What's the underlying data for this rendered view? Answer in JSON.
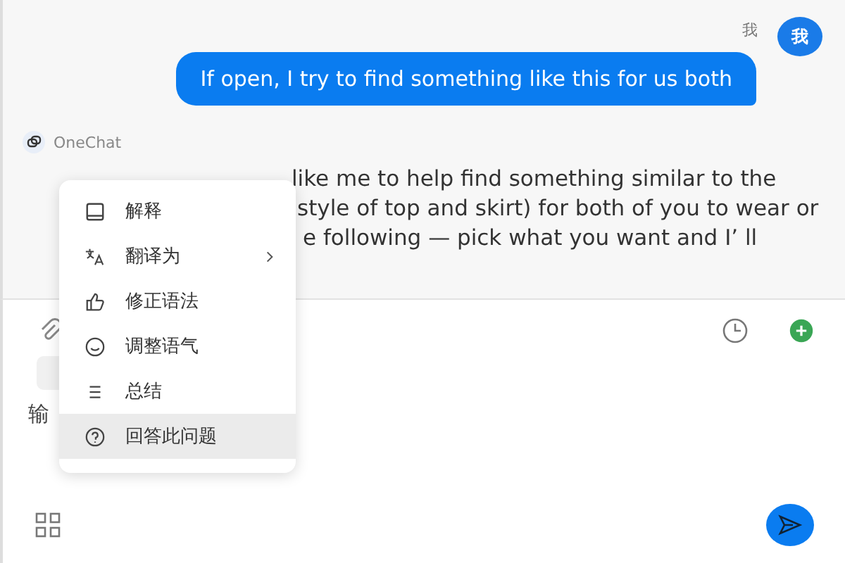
{
  "user_message": {
    "sender": "我",
    "avatar": "我",
    "text": "If open, I try to find something like this for us both"
  },
  "bot_message": {
    "sender": "OneChat",
    "lines": [
      "like me to help find something similar to the",
      "style of top and skirt) for both of you to wear or",
      "e following — pick what you want and I’ ll"
    ]
  },
  "context_menu": {
    "items": [
      {
        "label": "解释",
        "has_submenu": false,
        "hovered": false
      },
      {
        "label": "翻译为",
        "has_submenu": true,
        "hovered": false
      },
      {
        "label": "修正语法",
        "has_submenu": false,
        "hovered": false
      },
      {
        "label": "调整语气",
        "has_submenu": false,
        "hovered": false
      },
      {
        "label": "总结",
        "has_submenu": false,
        "hovered": false
      },
      {
        "label": "回答此问题",
        "has_submenu": false,
        "hovered": true
      }
    ]
  },
  "composer": {
    "placeholder": "输"
  }
}
